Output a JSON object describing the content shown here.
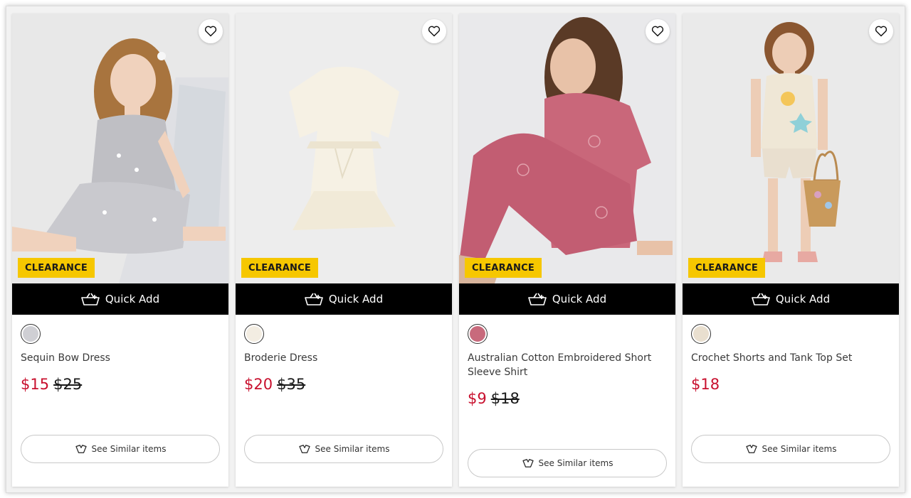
{
  "colors": {
    "badge": "#f6c700",
    "sale_price": "#c8102e",
    "quick_add_bg": "#000000"
  },
  "products": [
    {
      "badge": "CLEARANCE",
      "quick_add_label": "Quick Add",
      "swatch_color": "#cfcfd4",
      "title": "Sequin Bow Dress",
      "price_sale": "$15",
      "price_original": "$25",
      "similar_label": "See Similar items"
    },
    {
      "badge": "CLEARANCE",
      "quick_add_label": "Quick Add",
      "swatch_color": "#f3ede2",
      "title": "Broderie Dress",
      "price_sale": "$20",
      "price_original": "$35",
      "similar_label": "See Similar items"
    },
    {
      "badge": "CLEARANCE",
      "quick_add_label": "Quick Add",
      "swatch_color": "#c86a7c",
      "title": "Australian Cotton Embroidered Short Sleeve Shirt",
      "price_sale": "$9",
      "price_original": "$18",
      "similar_label": "See Similar items"
    },
    {
      "badge": "CLEARANCE",
      "quick_add_label": "Quick Add",
      "swatch_color": "#e9dfcf",
      "title": "Crochet Shorts and Tank Top Set",
      "price_sale": "$18",
      "price_original": "",
      "similar_label": "See Similar items"
    }
  ]
}
